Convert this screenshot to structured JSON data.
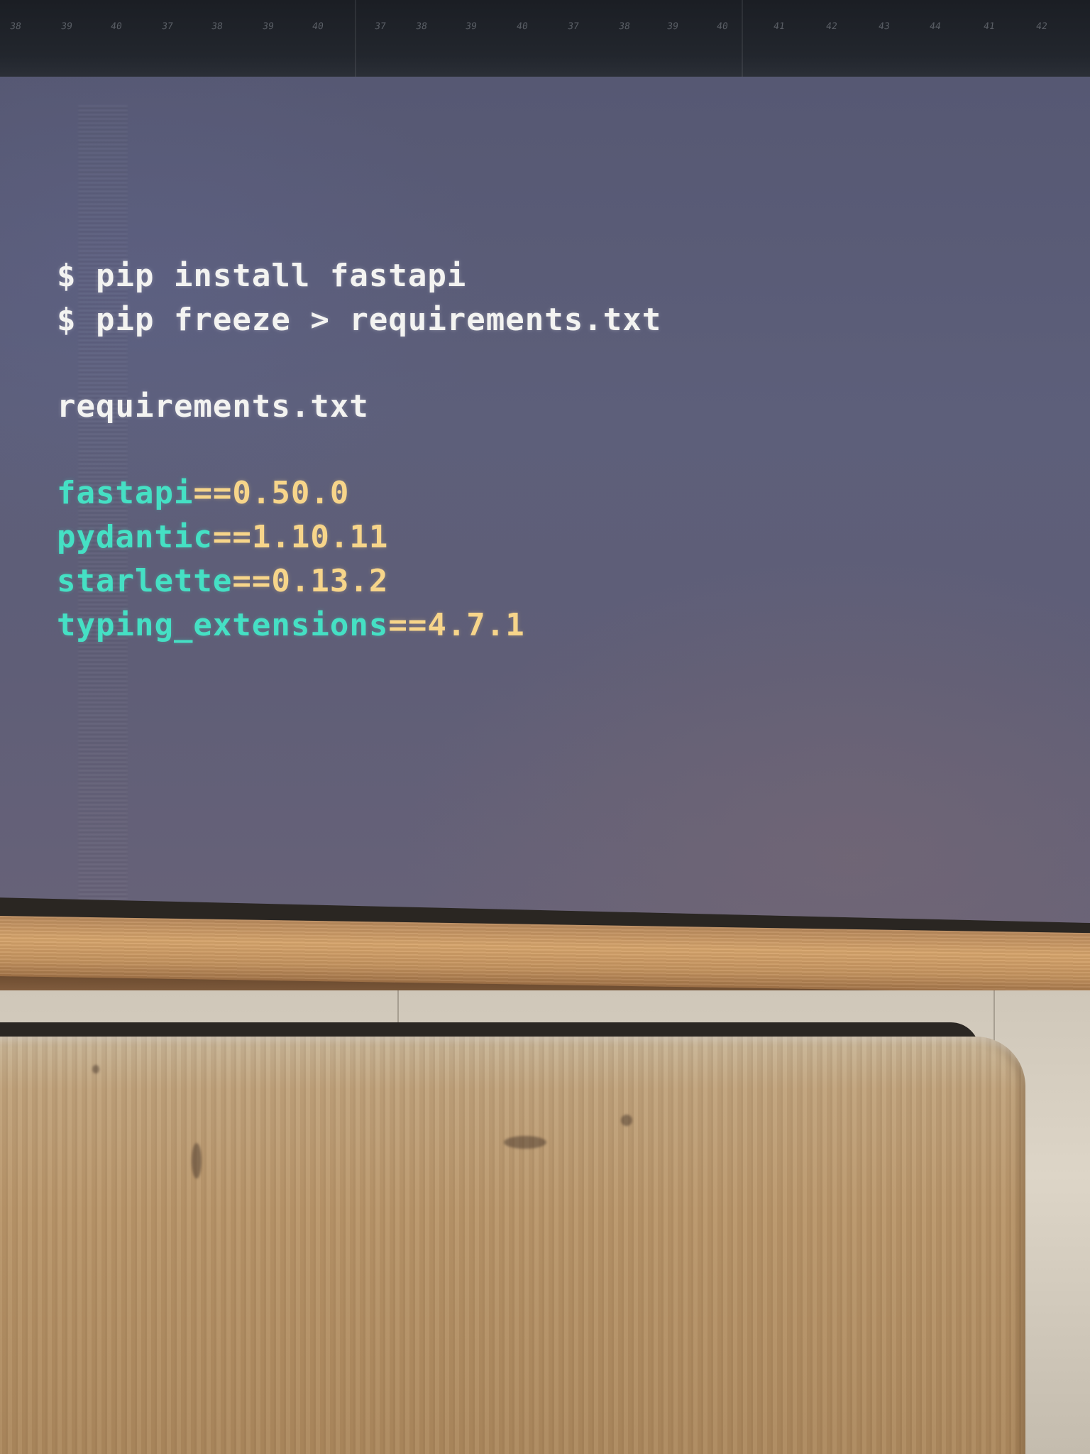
{
  "ruler_numbers": [
    "38",
    "39",
    "40",
    "37",
    "38",
    "39",
    "40",
    "37",
    "38",
    "39",
    "40",
    "37",
    "38",
    "39",
    "40",
    "41",
    "42",
    "43",
    "44",
    "41",
    "42"
  ],
  "terminal": {
    "commands": [
      "$ pip install fastapi",
      "$ pip freeze > requirements.txt"
    ],
    "file_heading": "requirements.txt",
    "requirements": [
      {
        "package": "fastapi",
        "separator": "==",
        "version": "0.50.0"
      },
      {
        "package": "pydantic",
        "separator": "==",
        "version": "1.10.11"
      },
      {
        "package": "starlette",
        "separator": "==",
        "version": "0.13.2"
      },
      {
        "package": "typing_extensions",
        "separator": "==",
        "version": "4.7.1"
      }
    ]
  },
  "colors": {
    "command_text": "#f3f3f1",
    "package_name": "#45e0c4",
    "version_text": "#f7d58a",
    "screen_bg": "#5d5f7a"
  }
}
